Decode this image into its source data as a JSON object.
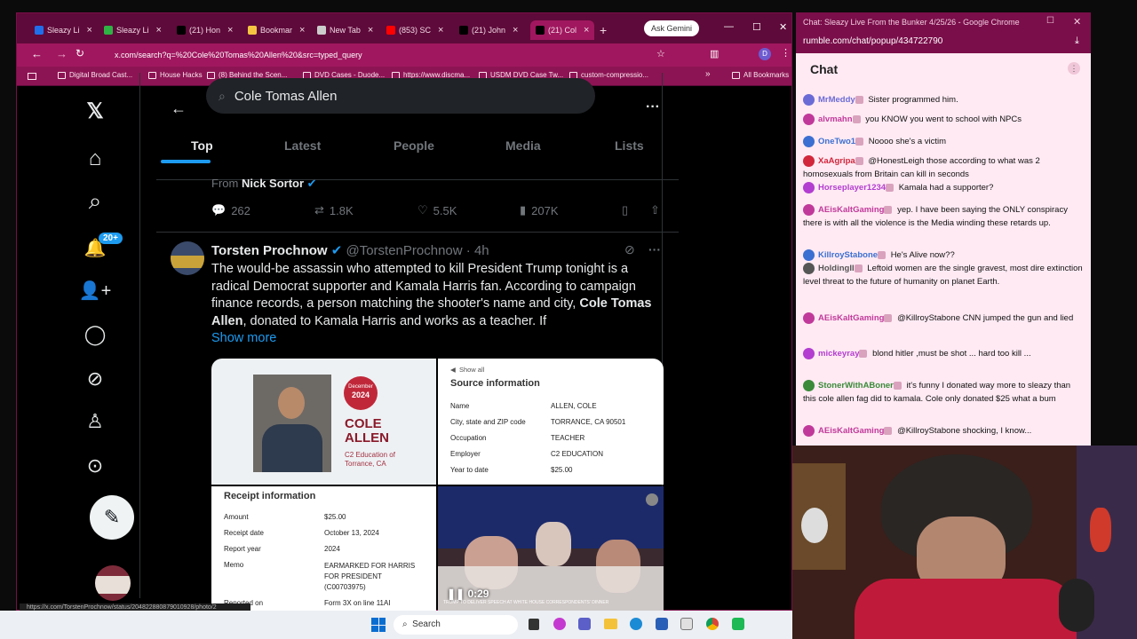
{
  "browser": {
    "tabs": [
      {
        "label": "Sleazy Li",
        "color": "#1f6feb"
      },
      {
        "label": "Sleazy Li",
        "color": "#2fb344"
      },
      {
        "label": "(21) Hon",
        "color": "#000000"
      },
      {
        "label": "Bookmar",
        "color": "#f5c542"
      },
      {
        "label": "New Tab",
        "color": "#cccccc"
      },
      {
        "label": "(853) SC",
        "color": "#ff0000"
      },
      {
        "label": "(21) John",
        "color": "#000000"
      },
      {
        "label": "(21) Col",
        "color": "#000000"
      }
    ],
    "ask_gemini": "Ask Gemini",
    "url": "x.com/search?q=%20Cole%20Tomas%20Allen%20&src=typed_query",
    "bookmarks": [
      "Digital Broad Cast...",
      "House Hacks",
      "(8) Behind the Scen...",
      "DVD Cases - Duode...",
      "https://www.discma...",
      "USDM DVD Case Tw...",
      "custom-compressio..."
    ],
    "all_bookmarks": "All Bookmarks",
    "status_link": "https://x.com/TorstenProchnow/status/204822880879010928/photo/2"
  },
  "x": {
    "search_value": "Cole Tomas Allen",
    "tabs": [
      "Top",
      "Latest",
      "People",
      "Media",
      "Lists"
    ],
    "notif_badge": "20+",
    "prev_tweet": {
      "from": "From",
      "author": "Nick Sortor",
      "replies": "262",
      "reposts": "1.8K",
      "likes": "5.5K",
      "views": "207K"
    },
    "tweet": {
      "name": "Torsten Prochnow",
      "handle": "@TorstenProchnow",
      "time": "· 4h",
      "text_a": "The would-be assassin who attempted to kill President Trump tonight is a radical Democrat supporter and Kamala Harris fan. According to campaign finance records, a person matching the shooter's name and city, ",
      "text_bold": "Cole Tomas Allen",
      "text_b": ", donated to Kamala Harris and works as a teacher. If",
      "show_more": "Show more"
    },
    "card_profile": {
      "badge_month": "December",
      "badge_year": "2024",
      "first": "COLE",
      "last": "ALLEN",
      "org": "C2 Education of Torrance, CA"
    },
    "card_source": {
      "show_all": "Show all",
      "title": "Source information",
      "rows": [
        [
          "Name",
          "ALLEN, COLE"
        ],
        [
          "City, state and ZIP code",
          "TORRANCE, CA 90501"
        ],
        [
          "Occupation",
          "TEACHER"
        ],
        [
          "Employer",
          "C2 EDUCATION"
        ],
        [
          "Year to date",
          "$25.00"
        ]
      ]
    },
    "card_receipt": {
      "title": "Receipt information",
      "rows": [
        [
          "Amount",
          "$25.00"
        ],
        [
          "Receipt date",
          "October 13, 2024"
        ],
        [
          "Report year",
          "2024"
        ],
        [
          "Memo",
          "EARMARKED FOR HARRIS FOR PRESIDENT (C00703975)"
        ],
        [
          "Reported on",
          "Form 3X on line 11AI"
        ]
      ]
    },
    "video": {
      "time": "0:29",
      "caption": "TRUMP TO DELIVER SPEECH AT WHITE HOUSE CORRESPONDENTS' DINNER"
    }
  },
  "chat": {
    "window_title": "Chat: Sleazy Live From the Bunker 4/25/26 - Google Chrome",
    "url": "rumble.com/chat/popup/434722790",
    "heading": "Chat",
    "messages": [
      {
        "user": "MrMeddy",
        "text": "Sister programmed him.",
        "color": "#6b6bd6"
      },
      {
        "user": "alvmahn",
        "text": "you KNOW you went to school with NPCs",
        "color": "#c0399a"
      },
      {
        "user": "OneTwo1",
        "text": "Noooo she's a victim",
        "color": "#3b6fd1"
      },
      {
        "user": "XaAgripa",
        "text": "@HonestLeigh those according to what was 2 homosexuals from Britain can kill in seconds",
        "color": "#d1263b"
      },
      {
        "user": "Horseplayer1234",
        "text": "Kamala had a supporter?",
        "color": "#b23dd0"
      },
      {
        "user": "AEisKaltGaming",
        "text": "yep. I have been saying the ONLY conspiracy there is with all the violence is the Media winding these retards up.",
        "color": "#c0399a"
      },
      {
        "user": "KillroyStabone",
        "text": "He's Alive now??",
        "color": "#3b6fd1"
      },
      {
        "user": "HoldingII",
        "text": "Leftoid women are the single gravest, most dire extinction level threat to the future of humanity on planet Earth.",
        "color": "#555555"
      },
      {
        "user": "AEisKaltGaming",
        "text": "@KillroyStabone CNN jumped the gun and lied",
        "color": "#c0399a"
      },
      {
        "user": "mickeyray",
        "text": "blond hitler ,must be shot ... hard too kill ...",
        "color": "#b23dd0"
      },
      {
        "user": "StonerWithABoner",
        "text": "it's funny I donated way more to sleazy than this cole allen fag did to kamala. Cole only donated $25 what a bum",
        "color": "#3a8a3a"
      },
      {
        "user": "AEisKaltGaming",
        "text": "@KillroyStabone shocking, I know...",
        "color": "#c0399a"
      }
    ]
  },
  "taskbar": {
    "search": "Search"
  }
}
